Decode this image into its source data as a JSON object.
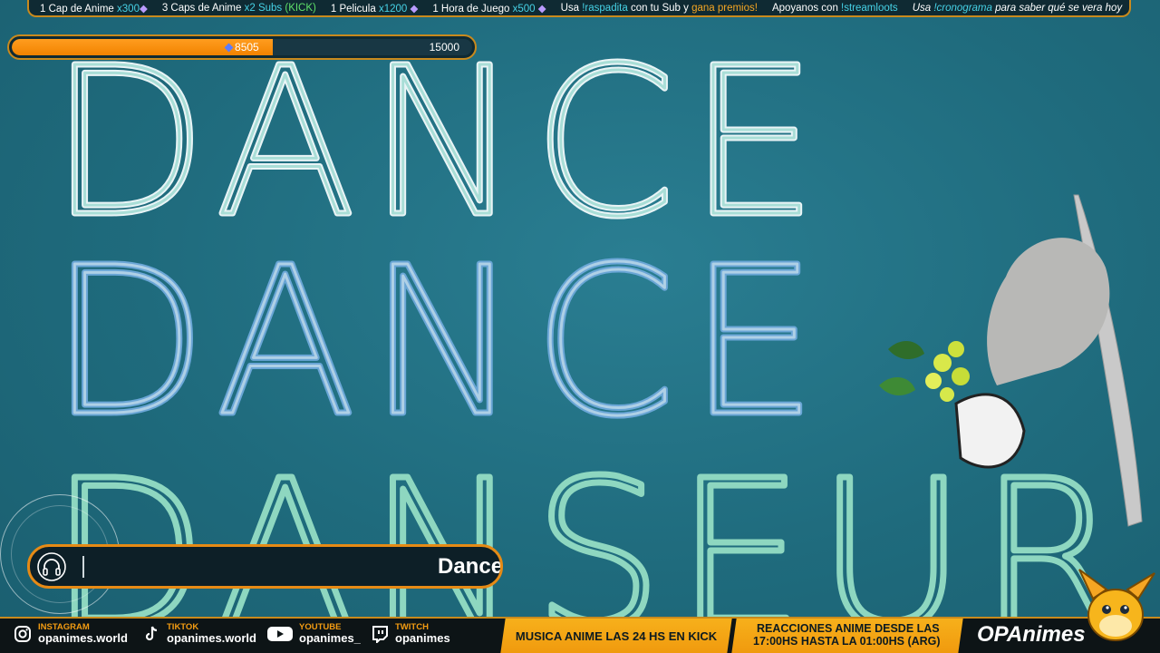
{
  "ticker": {
    "items": [
      {
        "pre": "1 Cap de Anime ",
        "num": "x300",
        "tail": ""
      },
      {
        "pre": "3 Caps de Anime ",
        "num": "x2 Subs",
        "tail": " (KICK)"
      },
      {
        "pre": "1 Pelicula ",
        "num": "x1200",
        "tail": ""
      },
      {
        "pre": "1 Hora de Juego ",
        "num": "x500",
        "tail": ""
      }
    ],
    "raspadita": {
      "a": "Usa ",
      "b": "!raspadita",
      "c": " con tu Sub y ",
      "d": "gana premios!"
    },
    "streamloots": {
      "a": "Apoyanos con ",
      "b": "!streamloots"
    },
    "cronograma": {
      "a": "Usa ",
      "b": "!cronograma",
      "c": " para saber qué se vera hoy"
    }
  },
  "goal": {
    "current": "8505",
    "target": "15000",
    "progress": 0.567
  },
  "lyrics_art": {
    "line1": "DANCE",
    "line2": "DANCE",
    "line3": "DANSEUR"
  },
  "now_playing": {
    "song": "Dance"
  },
  "socials": [
    {
      "platform": "INSTAGRAM",
      "handle": "opanimes.world",
      "icon": "instagram-icon"
    },
    {
      "platform": "TIKTOK",
      "handle": "opanimes.world",
      "icon": "tiktok-icon"
    },
    {
      "platform": "YOUTUBE",
      "handle": "opanimes_",
      "icon": "youtube-icon"
    },
    {
      "platform": "TWITCH",
      "handle": "opanimes",
      "icon": "twitch-icon"
    }
  ],
  "banners": {
    "music": "MUSICA ANIME LAS 24 HS EN KICK",
    "reactions_l1": "REACCIONES ANIME DESDE LAS",
    "reactions_l2": "17:00HS HASTA LA 01:00HS (ARG)"
  },
  "brand": "OPAnimes",
  "colors": {
    "accent": "#f39c12",
    "cyan": "#46d2e6",
    "green": "#5fe06a",
    "bg": "#1f6a7c"
  }
}
